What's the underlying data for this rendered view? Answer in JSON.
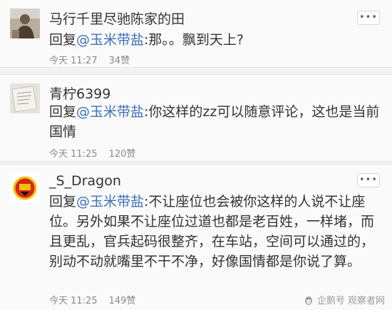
{
  "comments": [
    {
      "username": "马行千里尽驰陈家的田",
      "reply_prefix": "回复",
      "mention": "@玉米带盐",
      "text": ":那。。飘到天上?",
      "time": "今天 11:27",
      "likes": "34赞",
      "more": "•••",
      "avatar_icon": "avatar-person-photo"
    },
    {
      "username": "青柠6399",
      "reply_prefix": "回复",
      "mention": "@玉米带盐",
      "text": ":你这样的zz可以随意评论，这也是当前国情",
      "time": "今天 11:25",
      "likes": "120赞",
      "more": "•••",
      "avatar_icon": "avatar-paper-sketch"
    },
    {
      "username": "_S_Dragon",
      "reply_prefix": "回复",
      "mention": "@玉米带盐",
      "text": ":不让座位也会被你这样的人说不让座位。另外如果不让座位过道也都是老百姓，一样堵，而且更乱，官兵起码很整齐，在车站，空间可以通过的，别动不动就嘴里不干不净，好像国情都是你说了算。",
      "time": "今天 11:25",
      "likes": "149赞",
      "more": "•••",
      "avatar_icon": "avatar-club-crest"
    }
  ],
  "watermark": {
    "text": "企鹅号 观察者网",
    "icon": "penguin-icon"
  },
  "colors": {
    "mention": "#3c70b8",
    "background": "#f2f2f2",
    "card": "#fafafa"
  }
}
